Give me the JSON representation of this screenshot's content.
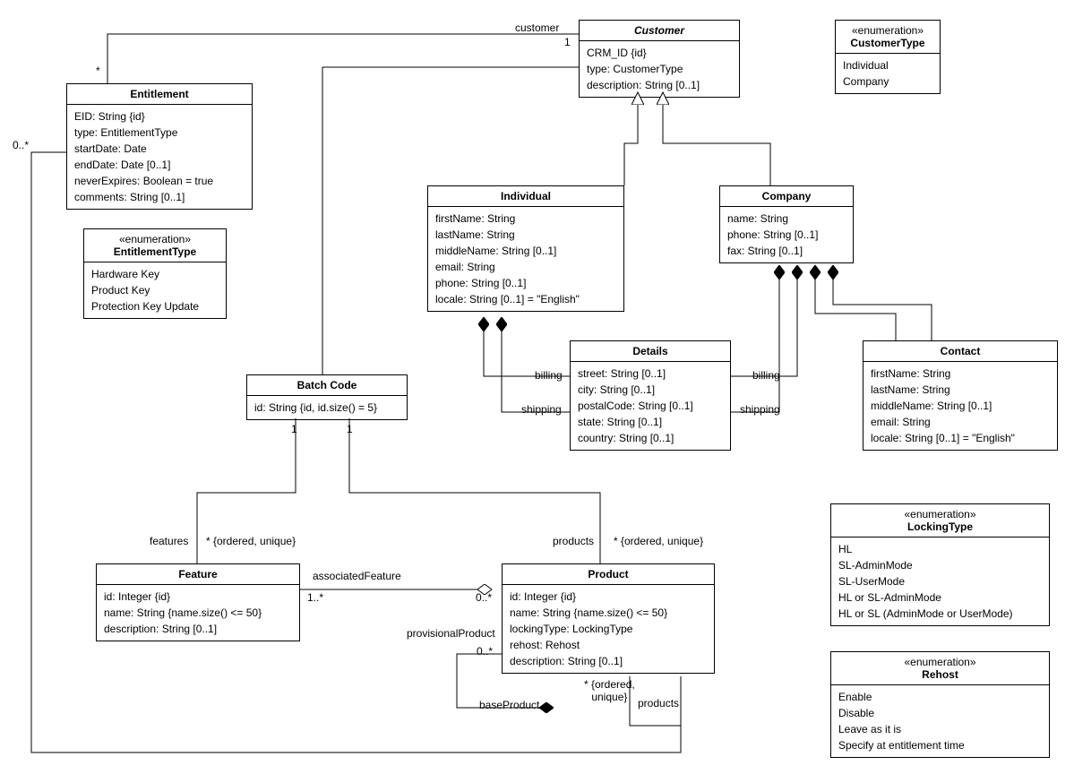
{
  "classes": {
    "entitlement": {
      "name": "Entitlement",
      "attrs": [
        "EID: String {id}",
        "type: EntitlementType",
        "startDate: Date",
        "endDate: Date [0..1]",
        "neverExpires: Boolean = true",
        "comments: String [0..1]"
      ]
    },
    "entitlementType": {
      "stereotype": "«enumeration»",
      "name": "EntitlementType",
      "literals": [
        "Hardware Key",
        "Product Key",
        "Protection Key Update"
      ]
    },
    "customer": {
      "name": "Customer",
      "attrs": [
        "CRM_ID {id}",
        "type: CustomerType",
        "description: String [0..1]"
      ]
    },
    "customerType": {
      "stereotype": "«enumeration»",
      "name": "CustomerType",
      "literals": [
        "Individual",
        "Company"
      ]
    },
    "individual": {
      "name": "Individual",
      "attrs": [
        "firstName: String",
        "lastName: String",
        "middleName: String [0..1]",
        "email: String",
        "phone: String [0..1]",
        "locale: String [0..1] = \"English\""
      ]
    },
    "company": {
      "name": "Company",
      "attrs": [
        "name: String",
        "phone: String [0..1]",
        "fax: String [0..1]"
      ]
    },
    "details": {
      "name": "Details",
      "attrs": [
        "street: String [0..1]",
        "city: String [0..1]",
        "postalCode: String [0..1]",
        "state: String [0..1]",
        "country: String [0..1]"
      ]
    },
    "contact": {
      "name": "Contact",
      "attrs": [
        "firstName: String",
        "lastName: String",
        "middleName: String [0..1]",
        "email: String",
        "locale: String [0..1] = \"English\""
      ]
    },
    "batchCode": {
      "name": "Batch Code",
      "attrs": [
        "id: String {id, id.size() = 5}"
      ]
    },
    "feature": {
      "name": "Feature",
      "attrs": [
        "id: Integer {id}",
        "name: String {name.size() <= 50}",
        "description: String [0..1]"
      ]
    },
    "product": {
      "name": "Product",
      "attrs": [
        "id: Integer {id}",
        "name: String {name.size() <= 50}",
        "lockingType: LockingType",
        "rehost: Rehost",
        "description: String [0..1]"
      ]
    },
    "lockingType": {
      "stereotype": "«enumeration»",
      "name": "LockingType",
      "literals": [
        "HL",
        "SL-AdminMode",
        "SL-UserMode",
        "HL or SL-AdminMode",
        "HL or SL (AdminMode or UserMode)"
      ]
    },
    "rehost": {
      "stereotype": "«enumeration»",
      "name": "Rehost",
      "literals": [
        "Enable",
        "Disable",
        "Leave as it is",
        "Specify at entitlement time"
      ]
    }
  },
  "labels": {
    "customerRole": "customer",
    "one": "1",
    "star": "*",
    "zeroStar": "0..*",
    "billing": "billing",
    "shipping": "shipping",
    "features": "features",
    "orderedUnique": "* {ordered, unique}",
    "associatedFeature": "associatedFeature",
    "onePlus": "1..*",
    "products": "products",
    "provisionalProduct": "provisionalProduct",
    "baseProduct": "baseProduct",
    "zeroStarB": "0..*"
  }
}
